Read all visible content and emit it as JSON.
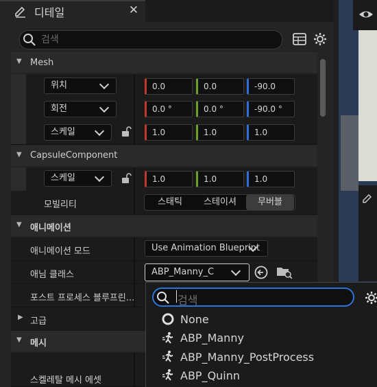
{
  "window": {
    "title": "디테일"
  },
  "search": {
    "placeholder": "검색"
  },
  "sections": {
    "mesh": {
      "label": "Mesh"
    },
    "capsule": {
      "label": "CapsuleComponent"
    },
    "animation": {
      "label": "애니메이션"
    },
    "advanced": {
      "label": "고급"
    },
    "mesh_kr": {
      "label": "메시"
    }
  },
  "transform": {
    "location": {
      "label": "위치",
      "x": "0.0",
      "y": "0.0",
      "z": "-90.0"
    },
    "rotation": {
      "label": "회전",
      "x": "0.0 °",
      "y": "0.0 °",
      "z": "-90.0 °"
    },
    "scale": {
      "label": "스케일",
      "x": "1.0",
      "y": "1.0",
      "z": "1.0"
    }
  },
  "capsule_scale": {
    "label": "스케일",
    "x": "1.0",
    "y": "1.0",
    "z": "1.0"
  },
  "mobility": {
    "label": "모빌리티",
    "options": [
      "스태틱",
      "스테이셔",
      "무버블"
    ],
    "selected": "무버블"
  },
  "animation": {
    "mode_label": "애니메이션 모드",
    "mode_value": "Use Animation Blueprint",
    "class_label": "애님 클래스",
    "class_value": "ABP_Manny_C",
    "post_process_label": "포스트 프로세스 블루프린..."
  },
  "skeletal_mesh_label": "스켈레탈 메시 에셋",
  "popup": {
    "search_placeholder": "검색",
    "items": [
      "None",
      "ABP_Manny",
      "ABP_Manny_PostProcess",
      "ABP_Quinn"
    ]
  },
  "colors": {
    "accent": "#2a75d8",
    "x_axis": "#c0392b",
    "y_axis": "#6ea128",
    "z_axis": "#2c6fd6"
  }
}
